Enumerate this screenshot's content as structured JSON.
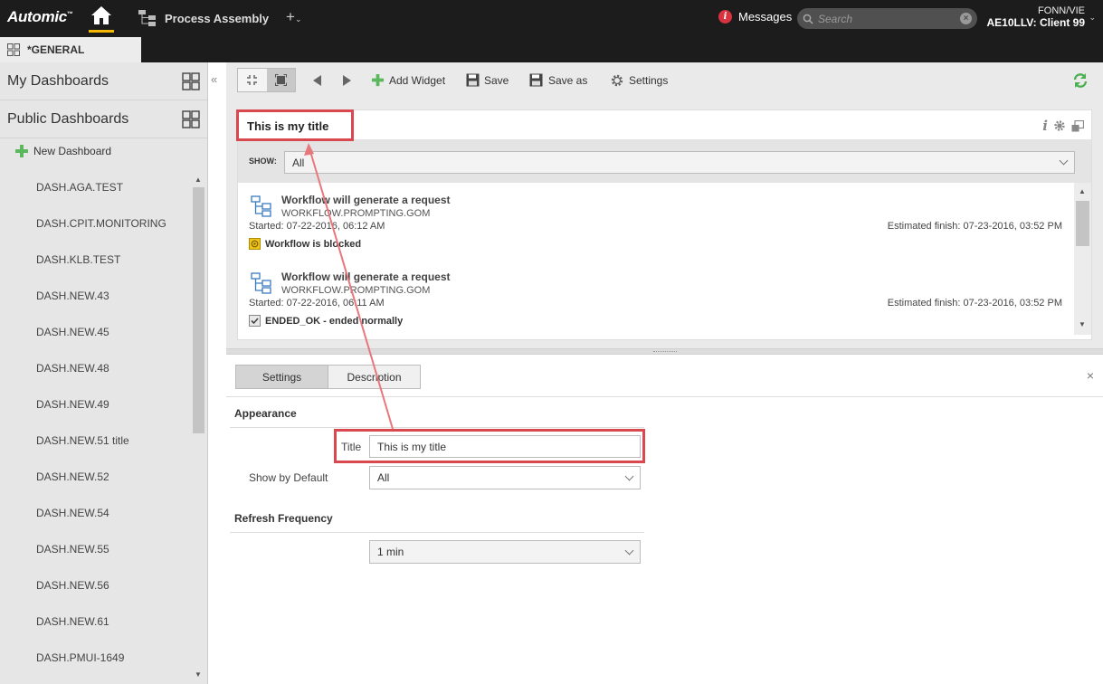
{
  "header": {
    "brand": "Automic",
    "brand_mark": "™",
    "process_label": "Process Assembly",
    "plus_label": "+",
    "plus_caret": "⌄",
    "messages_label": "Messages",
    "messages_badge": "i",
    "search_placeholder": "Search",
    "search_clear": "×",
    "user_line1": "FONN/VIE",
    "user_line2": "AE10LLV: Client 99",
    "user_caret": "⌄"
  },
  "tab": {
    "label": "*GENERAL"
  },
  "sidebar": {
    "my_dashboards": "My Dashboards",
    "public_dashboards": "Public Dashboards",
    "new_dashboard": "New Dashboard",
    "collapse": "«",
    "items": [
      "DASH.AGA.TEST",
      "DASH.CPIT.MONITORING",
      "DASH.KLB.TEST",
      "DASH.NEW.43",
      "DASH.NEW.45",
      "DASH.NEW.48",
      "DASH.NEW.49",
      "DASH.NEW.51 title",
      "DASH.NEW.52",
      "DASH.NEW.54",
      "DASH.NEW.55",
      "DASH.NEW.56",
      "DASH.NEW.61",
      "DASH.PMUI-1649"
    ],
    "scroll_up": "▲",
    "scroll_down": "▼"
  },
  "toolbar": {
    "add_widget": "Add Widget",
    "save": "Save",
    "save_as": "Save as",
    "settings": "Settings"
  },
  "widget": {
    "title": "This is my title",
    "info": "i",
    "show_label": "SHOW:",
    "show_value": "All",
    "workflows": [
      {
        "name": "Workflow will generate a request",
        "object": "WORKFLOW.PROMPTING.GOM",
        "started": "Started: 07-22-2016, 06:12 AM",
        "estimated": "Estimated finish: 07-23-2016, 03:52 PM",
        "status": "Workflow is blocked"
      },
      {
        "name": "Workflow will generate a request",
        "object": "WORKFLOW.PROMPTING.GOM",
        "started": "Started: 07-22-2016, 06:11 AM",
        "estimated": "Estimated finish: 07-23-2016, 03:52 PM",
        "status": "ENDED_OK - ended normally"
      }
    ],
    "scroll_up": "▲",
    "scroll_down": "▼"
  },
  "settings_pane": {
    "tab_settings": "Settings",
    "tab_description": "Description",
    "close": "×",
    "appearance": "Appearance",
    "title_label": "Title",
    "title_value": "This is my title",
    "show_default_label": "Show by Default",
    "show_default_value": "All",
    "refresh_frequency": "Refresh Frequency",
    "refresh_value": "1 min"
  },
  "colors": {
    "highlight": "#d9484e",
    "accent": "#f5b800",
    "topbar": "#1c1c1c"
  }
}
